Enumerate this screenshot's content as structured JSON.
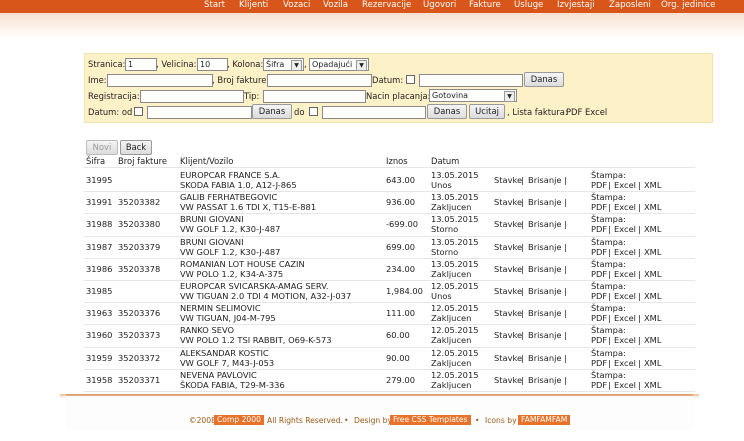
{
  "nav": [
    "Start",
    "Klijenti",
    "Vozaci",
    "Vozila",
    "Rezervacije",
    "Ugovori",
    "Fakture",
    "Usluge",
    "Izvjestaji",
    "Zaposleni",
    "Org. jedinice"
  ],
  "filter": {
    "stranica_label": "Stranica:",
    "stranica_value": "1",
    "velicina_label": ", Velicina:",
    "velicina_value": "10",
    "kolona_label": ", Kolona:",
    "kolona_value": "Šifra",
    "sort_value": "Opadajući",
    "ime_label": "Ime:",
    "broj_label": ", Broj fakture:",
    "datum_label": "Datum:",
    "danas_label": "Danas",
    "registracija_label": "Registracija:",
    "tip_label": "Tip:",
    "nacin_label": "Nacin placanja:",
    "nacin_value": "Gotovina",
    "datum_od_label": "Datum: od",
    "do_label": "do",
    "ucitaj_label": "Ucitaj",
    "lista_label": ", Lista faktura:",
    "pdf_label": "PDF",
    "excel_label": "Excel"
  },
  "toolbar": {
    "novi_label": "Novi",
    "back_label": "Back"
  },
  "columns": {
    "sifra": "Šifra",
    "broj": "Broj fakture",
    "klijent": "Klijent/Vozilo",
    "iznos": "Iznos",
    "datum": "Datum"
  },
  "actions": {
    "stavke": "Stavke",
    "brisanje": "Brisanje",
    "stampa": "Štampa:",
    "pdf": "PDF",
    "excel": "Excel",
    "xml": "XML"
  },
  "rows": [
    {
      "sifra": "31995",
      "broj": "",
      "klijent": "EUROPCAR FRANCE S.A.",
      "vozilo": "SKODA FABIA 1.0, A12-J-865",
      "iznos": "643.00",
      "datum": "13.05.2015",
      "status": "Unos"
    },
    {
      "sifra": "31991",
      "broj": "35203382",
      "klijent": "GALIB FERHATBEGOVIC",
      "vozilo": "VW PASSAT 1.6 TDI X, T15-E-881",
      "iznos": "936.00",
      "datum": "13.05.2015",
      "status": "Zakljucen"
    },
    {
      "sifra": "31988",
      "broj": "35203380",
      "klijent": "BRUNI GIOVANI",
      "vozilo": "VW GOLF 1.2, K30-J-487",
      "iznos": "-699.00",
      "datum": "13.05.2015",
      "status": "Storno"
    },
    {
      "sifra": "31987",
      "broj": "35203379",
      "klijent": "BRUNI GIOVANI",
      "vozilo": "VW GOLF 1.2, K30-J-487",
      "iznos": "699.00",
      "datum": "13.05.2015",
      "status": "Storno"
    },
    {
      "sifra": "31986",
      "broj": "35203378",
      "klijent": "ROMANIAN LOT HOUSE CAZIN",
      "vozilo": "VW POLO 1.2, K34-A-375",
      "iznos": "234.00",
      "datum": "13.05.2015",
      "status": "Zakljucen"
    },
    {
      "sifra": "31985",
      "broj": "",
      "klijent": "EUROPCAR SVICARSKA-AMAG SERV.",
      "vozilo": "VW TIGUAN 2.0 TDI 4 MOTION, A32-J-037",
      "iznos": "1,984.00",
      "datum": "12.05.2015",
      "status": "Unos"
    },
    {
      "sifra": "31963",
      "broj": "35203376",
      "klijent": "NERMIN SELIMOVIC",
      "vozilo": "VW TIGUAN, J04-M-795",
      "iznos": "111.00",
      "datum": "12.05.2015",
      "status": "Zakljucen"
    },
    {
      "sifra": "31960",
      "broj": "35203373",
      "klijent": "RANKO SEVO",
      "vozilo": "VW POLO 1.2 TSI RABBIT, O69-K-573",
      "iznos": "60.00",
      "datum": "12.05.2015",
      "status": "Zakljucen"
    },
    {
      "sifra": "31959",
      "broj": "35203372",
      "klijent": "ALEKSANDAR KOSTIC",
      "vozilo": "VW GOLF 7, M43-J-053",
      "iznos": "90.00",
      "datum": "12.05.2015",
      "status": "Zakljucen"
    },
    {
      "sifra": "31958",
      "broj": "35203371",
      "klijent": "NEVENA PAVLOVIC",
      "vozilo": "ŠKODA FABIA, T29-M-336",
      "iznos": "279.00",
      "datum": "12.05.2015",
      "status": "Zakljucen"
    }
  ],
  "footer": {
    "copy": "©2008",
    "company": "Comp 2000",
    "rights": "All Rights Reserved.",
    "design_by": "Design by",
    "design_link": "Free CSS Templates",
    "icons_by": "Icons by",
    "icons_link": "FAMFAMFAM"
  },
  "colors": {
    "accent": "#d9561a",
    "filter_bg": "#fdf1c8",
    "badge": "#e8722a"
  }
}
